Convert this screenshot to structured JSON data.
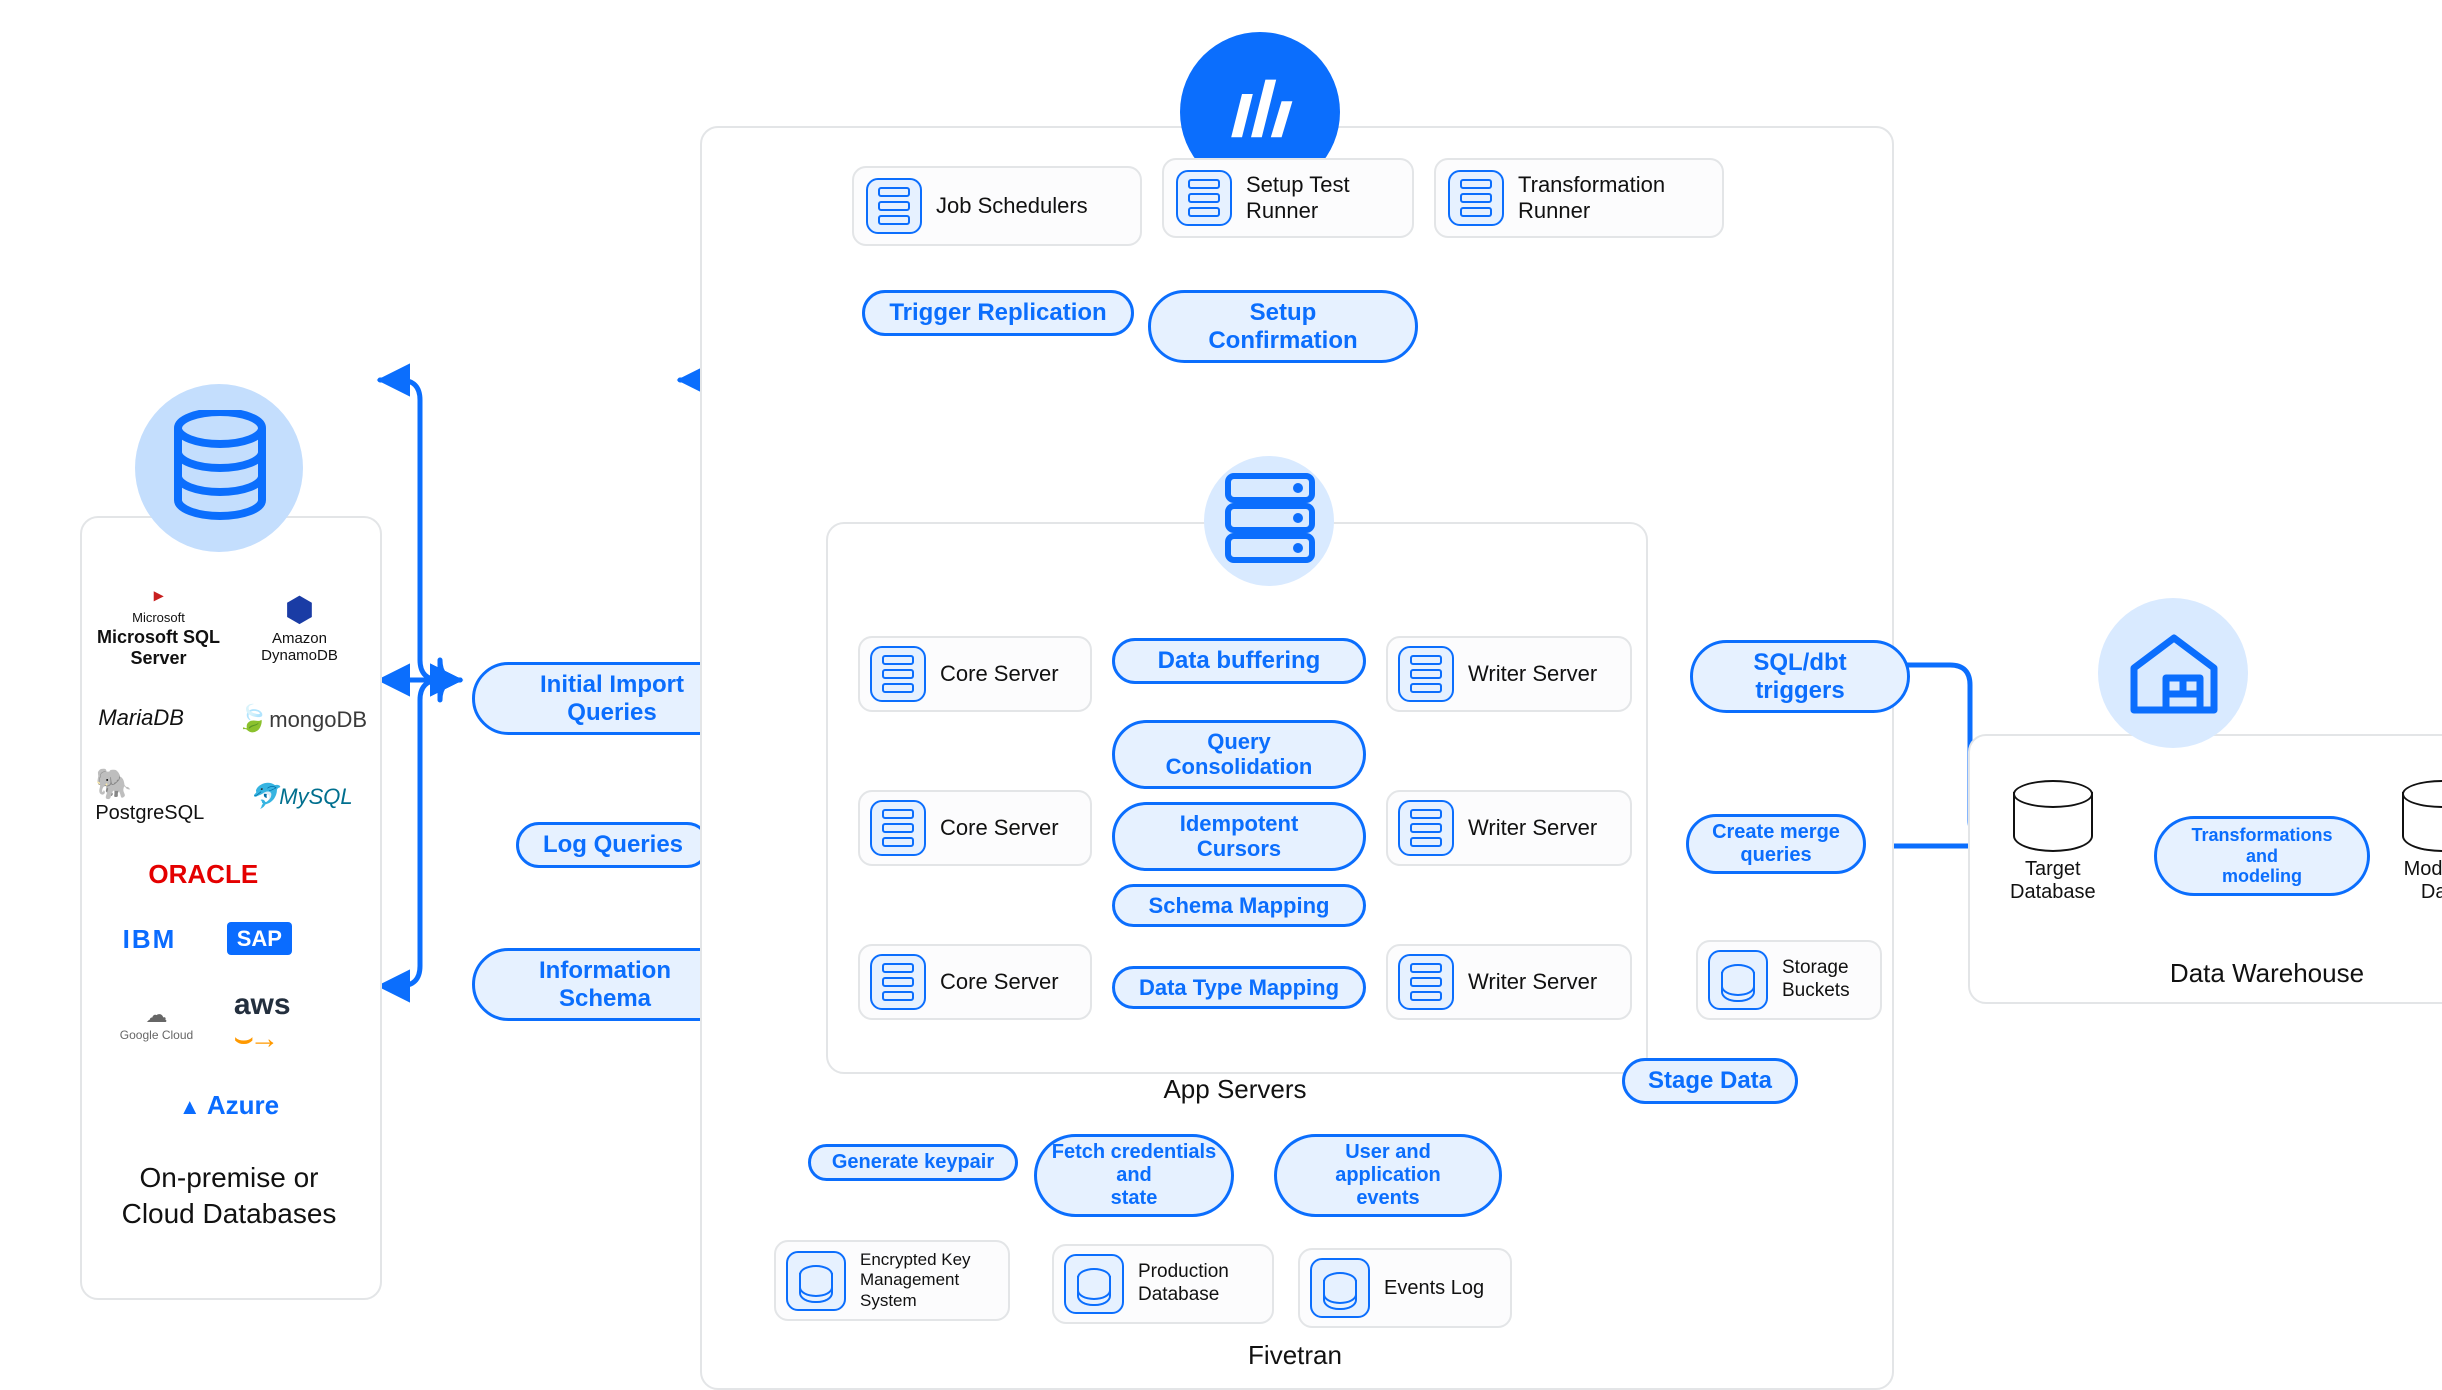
{
  "left_panel": {
    "title": "On-premise or\nCloud Databases",
    "logos": [
      {
        "name": "Microsoft SQL Server",
        "color": "#c81f1f"
      },
      {
        "name": "Amazon DynamoDB",
        "color": "#1a3ca5"
      },
      {
        "name": "MariaDB",
        "color": "#3a3a3a"
      },
      {
        "name": "mongoDB",
        "color": "#3f9c35"
      },
      {
        "name": "PostgreSQL",
        "color": "#2f5c8f"
      },
      {
        "name": "MySQL",
        "color": "#006f8e"
      },
      {
        "name": "ORACLE",
        "color": "#e40000"
      },
      {
        "name": "IBM",
        "color": "#0a6cff"
      },
      {
        "name": "SAP",
        "color": "#0a6cff"
      },
      {
        "name": "Google Cloud",
        "color": "#888"
      },
      {
        "name": "aws",
        "color": "#232f3e"
      },
      {
        "name": "Azure",
        "color": "#0a6cff"
      }
    ]
  },
  "source_queries": {
    "initial_import": "Initial Import Queries",
    "log_queries": "Log Queries",
    "info_schema": "Information Schema"
  },
  "fivetran": {
    "section_label": "Fivetran",
    "top_nodes": {
      "job_schedulers": "Job Schedulers",
      "setup_test_runner": "Setup Test\nRunner",
      "transformation_runner": "Transformation\nRunner"
    },
    "top_pills": {
      "trigger_replication": "Trigger Replication",
      "setup_confirmation": "Setup Confirmation"
    },
    "app_servers": {
      "section_label": "App Servers",
      "core": [
        "Core Server",
        "Core Server",
        "Core Server"
      ],
      "writer": [
        "Writer Server",
        "Writer Server",
        "Writer Server"
      ],
      "middle_pills": [
        "Data buffering",
        "Query Consolidation",
        "Idempotent Cursors",
        "Schema Mapping",
        "Data Type Mapping"
      ]
    },
    "bottom_pills": {
      "generate_keypair": "Generate keypair",
      "fetch_credentials": "Fetch credentials and\nstate",
      "user_events": "User and application\nevents"
    },
    "bottom_nodes": {
      "ekms": "Encrypted Key\nManagement\nSystem",
      "prod_db": "Production\nDatabase",
      "events_log": "Events Log"
    }
  },
  "right_flow": {
    "sql_dbt_triggers": "SQL/dbt triggers",
    "create_merge_queries": "Create merge\nqueries",
    "stage_data": "Stage Data",
    "storage_buckets": "Storage\nBuckets"
  },
  "warehouse": {
    "section_label": "Data Warehouse",
    "target_db": "Target\nDatabase",
    "transform_pill": "Transformations and\nmodeling",
    "modeled_data": "Modeled\nData"
  },
  "colors": {
    "blue": "#0b6efd",
    "blue_bg": "#e6f1ff",
    "blue_light": "#c4defd",
    "grey": "#e3e5e7"
  }
}
